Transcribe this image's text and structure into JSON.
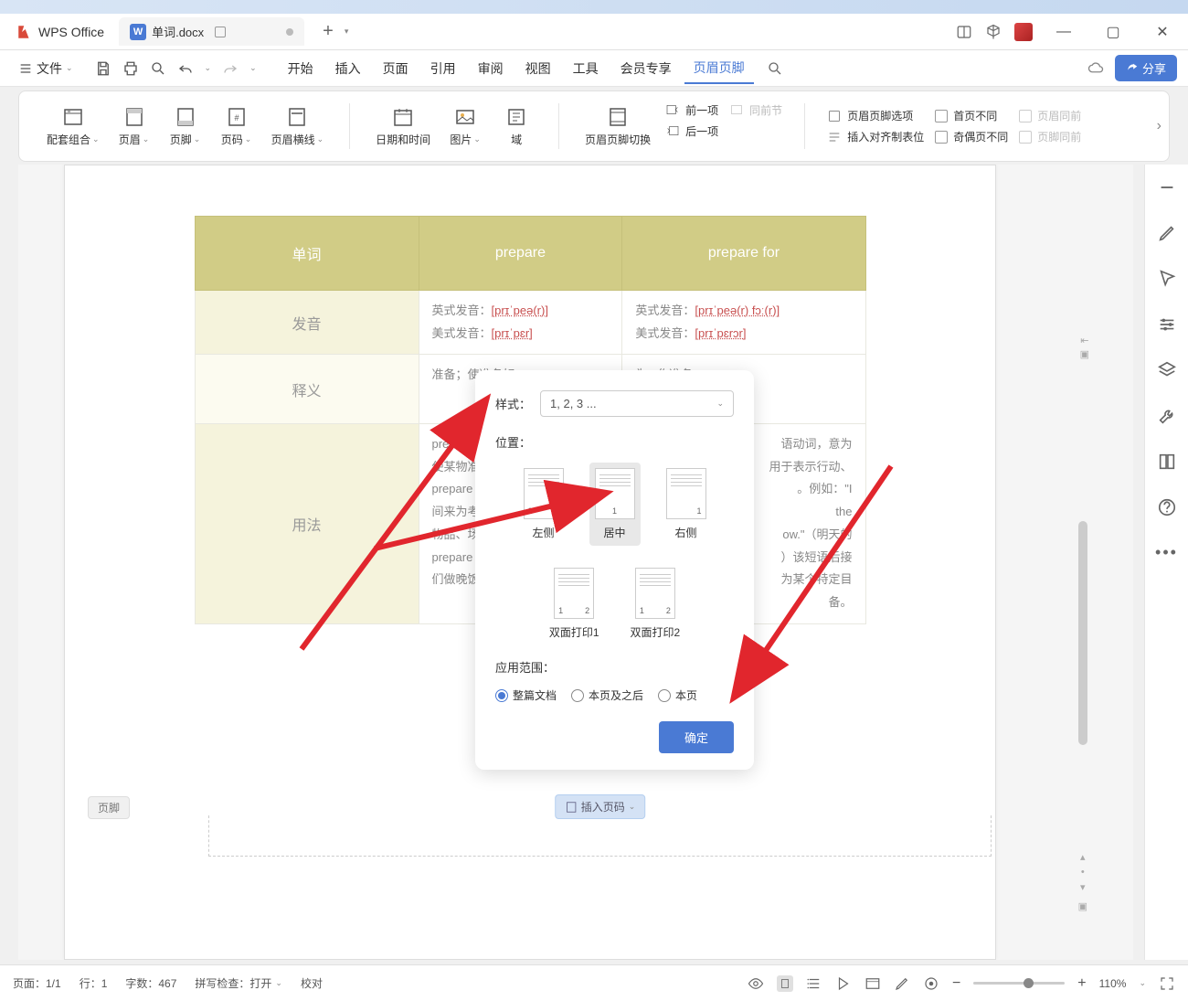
{
  "app": {
    "name": "WPS Office"
  },
  "tabs": {
    "doc_name": "单词.docx",
    "doc_badge": "W"
  },
  "window": {
    "add_tab": "+"
  },
  "file_menu": "文件",
  "menu": {
    "start": "开始",
    "insert": "插入",
    "page": "页面",
    "reference": "引用",
    "review": "审阅",
    "view": "视图",
    "tools": "工具",
    "member": "会员专享",
    "header_footer": "页眉页脚"
  },
  "share_btn": "分享",
  "ribbon": {
    "combo": "配套组合",
    "header": "页眉",
    "footer": "页脚",
    "pagenum": "页码",
    "header_line": "页眉横线",
    "datetime": "日期和时间",
    "picture": "图片",
    "field": "域",
    "switch": "页眉页脚切换",
    "prev": "前一项",
    "next": "后一项",
    "same_prev": "同前节",
    "options": "页眉页脚选项",
    "insert_align": "插入对齐制表位",
    "first_diff": "首页不同",
    "odd_even": "奇偶页不同",
    "header_same": "页眉同前",
    "footer_same": "页脚同前"
  },
  "table": {
    "headers": {
      "word": "单词",
      "col1": "prepare",
      "col2": "prepare for"
    },
    "rows": {
      "pron": {
        "label": "发音",
        "c1_uk_label": "英式发音：",
        "c1_uk": "[prɪˈpeə(r)]",
        "c1_us_label": "美式发音：",
        "c1_us": "[prɪˈpɛr]",
        "c2_uk_label": "英式发音：",
        "c2_uk": "[prɪˈpeə(r) fɔː(r)]",
        "c2_us_label": "美式发音：",
        "c2_us": "[prɪˈpɛrɔr]"
      },
      "meaning": {
        "label": "释义",
        "c1": "准备；使准备好。",
        "c2": "为...作准备。"
      },
      "usage": {
        "label": "用法",
        "c1a": "prepare ",
        "c1b": "使某物准备",
        "c1c": "prepare fo",
        "c1d": "间来为考试",
        "c1e": "物品、场地",
        "c1f": "prepare d",
        "c1g": "们做晚饭。",
        "c2a": "语动词，意为",
        "c2b": "用于表示行动、",
        "c2c": "。例如：\"I",
        "c2d": "the",
        "c2e": "ow.\"（明天的",
        "c2f": "）该短语后接",
        "c2g": "为某个特定目",
        "c2h": "备。"
      }
    }
  },
  "footer": {
    "tag": "页脚",
    "insert_btn": "插入页码"
  },
  "dialog": {
    "style_label": "样式：",
    "style_value": "1, 2, 3 ...",
    "position_label": "位置：",
    "pos_left": "左侧",
    "pos_center": "居中",
    "pos_right": "右侧",
    "pos_dup1": "双面打印1",
    "pos_dup2": "双面打印2",
    "scope_label": "应用范围：",
    "scope_all": "整篇文档",
    "scope_after": "本页及之后",
    "scope_this": "本页",
    "confirm": "确定"
  },
  "status": {
    "page": "页面：1/1",
    "line": "行：1",
    "words": "字数：467",
    "spell": "拼写检查：打开",
    "proof": "校对",
    "zoom": "110%"
  }
}
